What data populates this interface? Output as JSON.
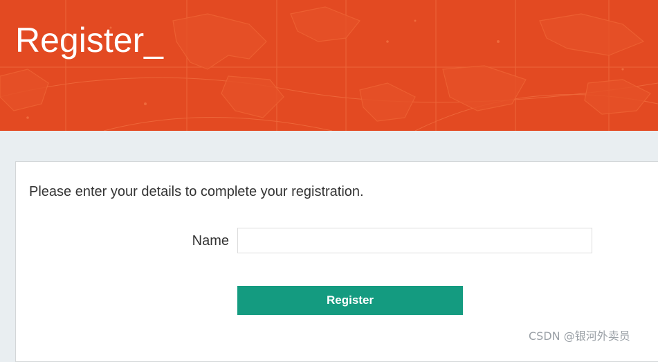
{
  "header": {
    "title": "Register_",
    "background_color": "#e34a22"
  },
  "form": {
    "intro": "Please enter your details to complete your registration.",
    "name_label": "Name",
    "name_value": "",
    "submit_label": "Register",
    "button_color": "#149b80"
  },
  "watermark": "CSDN @银河外卖员"
}
